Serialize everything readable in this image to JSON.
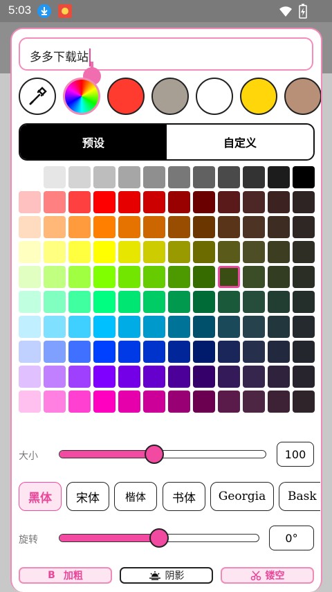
{
  "status": {
    "time": "5:03"
  },
  "text_input": {
    "value": "多多下载站"
  },
  "colors": {
    "accent": "#f24aa0",
    "swatches": [
      "#ff3b30",
      "#a89f94",
      "#ffffff",
      "#ffd60a",
      "#b89078"
    ],
    "selected_cell": "#3a4d12"
  },
  "tabs": [
    {
      "label": "预设",
      "active": true
    },
    {
      "label": "自定义",
      "active": false
    }
  ],
  "palette": [
    [
      "",
      "#e6e6e6",
      "#d4d4d4",
      "#bdbdbd",
      "#a6a6a6",
      "#8f8f8f",
      "#787878",
      "#616161",
      "#4a4a4a",
      "#333333",
      "#1c1c1c",
      "#000000"
    ],
    [
      "#ffc0c0",
      "#ff8080",
      "#ff4040",
      "#ff0000",
      "#e60000",
      "#cc0000",
      "#990000",
      "#6b0000",
      "#5a1a1a",
      "#4d2626",
      "#3d2222",
      "#2e2424"
    ],
    [
      "#ffdcc0",
      "#ffb877",
      "#ff9a3d",
      "#ff8000",
      "#e67300",
      "#cc6600",
      "#994d00",
      "#6b3600",
      "#5a3419",
      "#4d3323",
      "#3d2c22",
      "#2e2724"
    ],
    [
      "#ffffc0",
      "#ffff80",
      "#ffff40",
      "#ffff00",
      "#e6e600",
      "#cccc00",
      "#999900",
      "#6b6b00",
      "#5a5a1a",
      "#4d4d26",
      "#3d3d22",
      "#2e2e24"
    ],
    [
      "#e0ffc0",
      "#c0ff80",
      "#a0ff40",
      "#80ff00",
      "#73e600",
      "#66cc00",
      "#4d9900",
      "#366b00",
      "#3a4d12",
      "#3b4d26",
      "#323d22",
      "#2a2e24"
    ],
    [
      "#c0ffe0",
      "#80ffc0",
      "#40ffa0",
      "#00ff80",
      "#00e673",
      "#00cc66",
      "#00994d",
      "#006b36",
      "#1a5a3a",
      "#264d3b",
      "#223d32",
      "#242e2a"
    ],
    [
      "#c0f0ff",
      "#80e0ff",
      "#40d0ff",
      "#00c0ff",
      "#00ace6",
      "#0099cc",
      "#007399",
      "#00506b",
      "#1a4a5a",
      "#26434d",
      "#22363d",
      "#242a2e"
    ],
    [
      "#c0d0ff",
      "#80a0ff",
      "#4070ff",
      "#0040ff",
      "#0039e6",
      "#0033cc",
      "#002699",
      "#001b6b",
      "#1a255a",
      "#26304d",
      "#22283d",
      "#24262e"
    ],
    [
      "#e0c0ff",
      "#c080ff",
      "#a040ff",
      "#8000ff",
      "#7300e6",
      "#6600cc",
      "#4d0099",
      "#36006b",
      "#351a5a",
      "#36264d",
      "#2e223d",
      "#28242e"
    ],
    [
      "#ffc0f0",
      "#ff80e0",
      "#ff40d0",
      "#ff00c0",
      "#e600ac",
      "#cc0099",
      "#990073",
      "#6b0050",
      "#5a1a4a",
      "#4d2643",
      "#3d2236",
      "#2e242a"
    ]
  ],
  "size": {
    "label": "大小",
    "value": "100",
    "fraction": 0.46
  },
  "fonts": [
    {
      "label": "黑体",
      "active": true
    },
    {
      "label": "宋体",
      "active": false
    },
    {
      "label": "楷体",
      "active": false
    },
    {
      "label": "书体",
      "active": false
    },
    {
      "label": "Georgia",
      "active": false
    },
    {
      "label": "Bask",
      "active": false
    }
  ],
  "rotate": {
    "label": "旋转",
    "value": "0°",
    "fraction": 0.5
  },
  "actions": {
    "bold": "加粗",
    "bold_prefix": "B",
    "shadow": "阴影",
    "hollow": "镂空"
  }
}
